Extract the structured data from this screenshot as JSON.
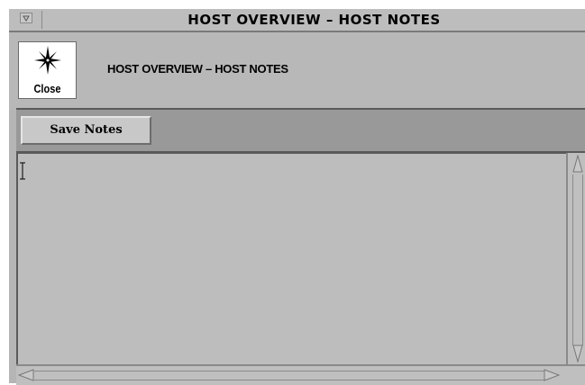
{
  "window": {
    "title": "HOST OVERVIEW – HOST NOTES"
  },
  "header": {
    "close_label": "Close",
    "close_icon": "compass-star-icon",
    "page_title": "HOST OVERVIEW – HOST NOTES"
  },
  "toolbar": {
    "save_label": "Save Notes"
  },
  "notes": {
    "value": ""
  },
  "colors": {
    "window_bg": "#b5b5b5",
    "toolbar_bg": "#999999",
    "notes_bg": "#bdbdbd"
  }
}
